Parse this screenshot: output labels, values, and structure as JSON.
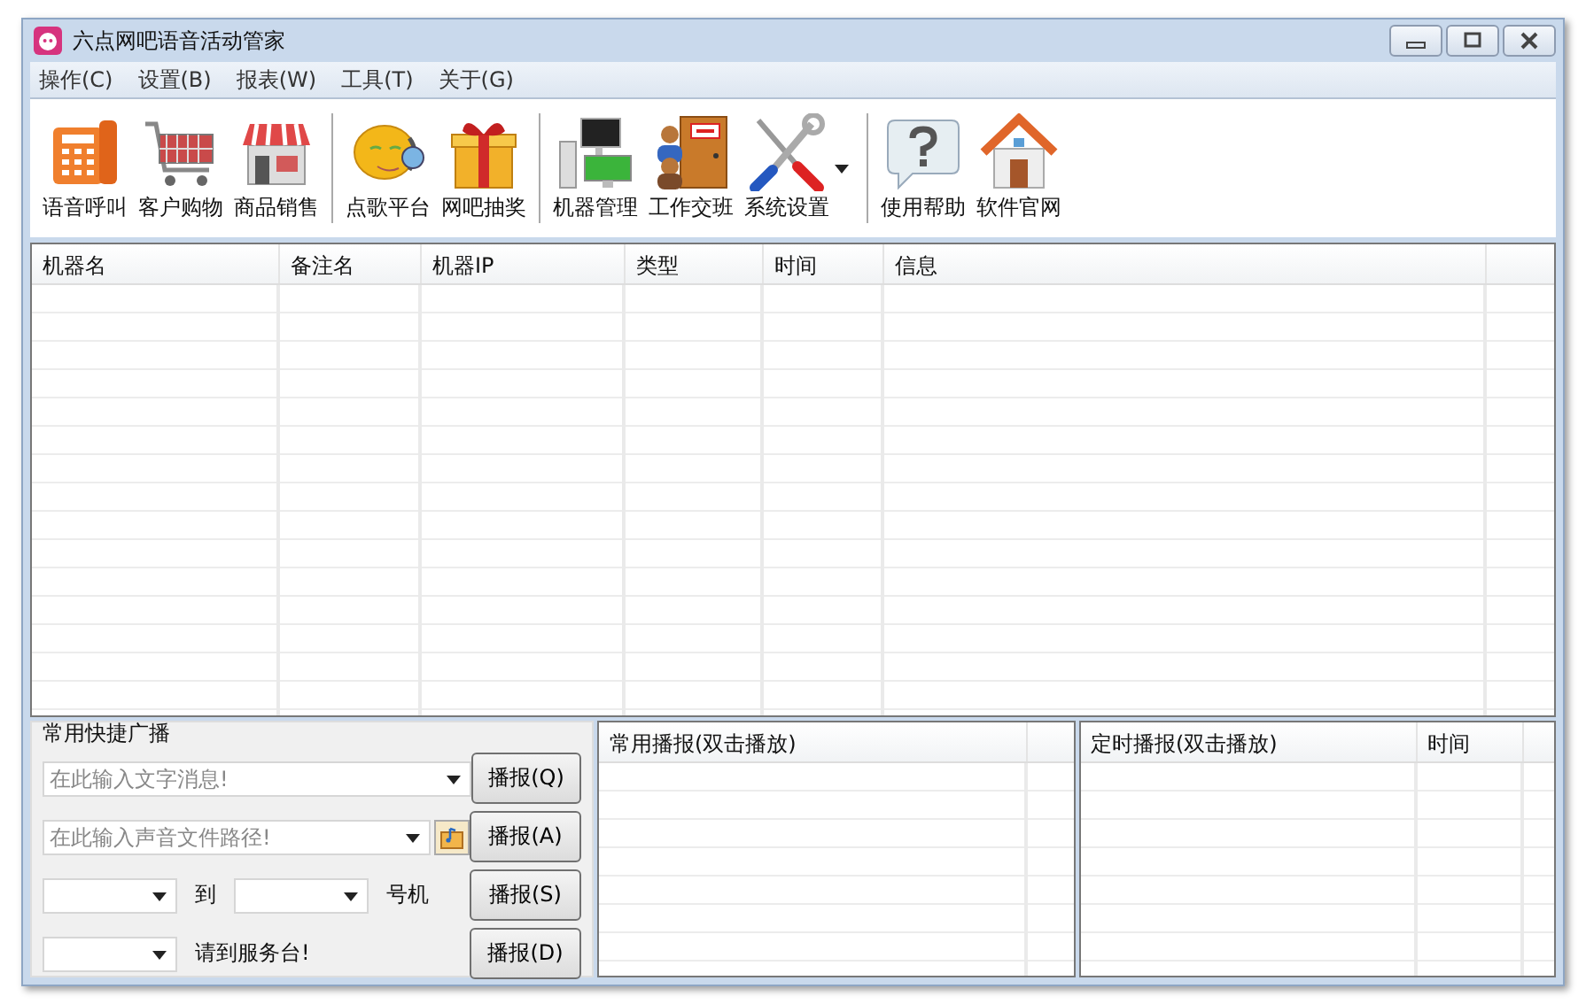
{
  "window": {
    "title": "六点网吧语音活动管家"
  },
  "menu": [
    "操作(C)",
    "设置(B)",
    "报表(W)",
    "工具(T)",
    "关于(G)"
  ],
  "toolbar": {
    "groups": [
      [
        {
          "label": "语音呼叫",
          "has_dropdown": false
        },
        {
          "label": "客户购物",
          "has_dropdown": false
        },
        {
          "label": "商品销售",
          "has_dropdown": false
        }
      ],
      [
        {
          "label": "点歌平台",
          "has_dropdown": false
        },
        {
          "label": "网吧抽奖",
          "has_dropdown": false
        }
      ],
      [
        {
          "label": "机器管理",
          "has_dropdown": false
        },
        {
          "label": "工作交班",
          "has_dropdown": false
        },
        {
          "label": "系统设置",
          "has_dropdown": true
        }
      ],
      [
        {
          "label": "使用帮助",
          "has_dropdown": false
        },
        {
          "label": "软件官网",
          "has_dropdown": false
        }
      ]
    ]
  },
  "machine_table": {
    "columns": [
      "机器名",
      "备注名",
      "机器IP",
      "类型",
      "时间",
      "信息"
    ]
  },
  "quick_broadcast": {
    "title": "常用快捷广播",
    "rows": [
      {
        "kind": "message",
        "placeholder": "在此输入文字消息!",
        "button": "播报(Q)"
      },
      {
        "kind": "file",
        "placeholder": "在此输入声音文件路径!",
        "button": "播报(A)"
      },
      {
        "kind": "range",
        "between": "到",
        "suffix": "号机",
        "button": "播报(S)"
      },
      {
        "kind": "desk",
        "suffix": "请到服务台!",
        "button": "播报(D)"
      }
    ]
  },
  "common_list": {
    "columns": [
      "常用播报(双击播放)"
    ]
  },
  "timed_list": {
    "columns": [
      "定时播报(双击播放)",
      "时间"
    ]
  }
}
